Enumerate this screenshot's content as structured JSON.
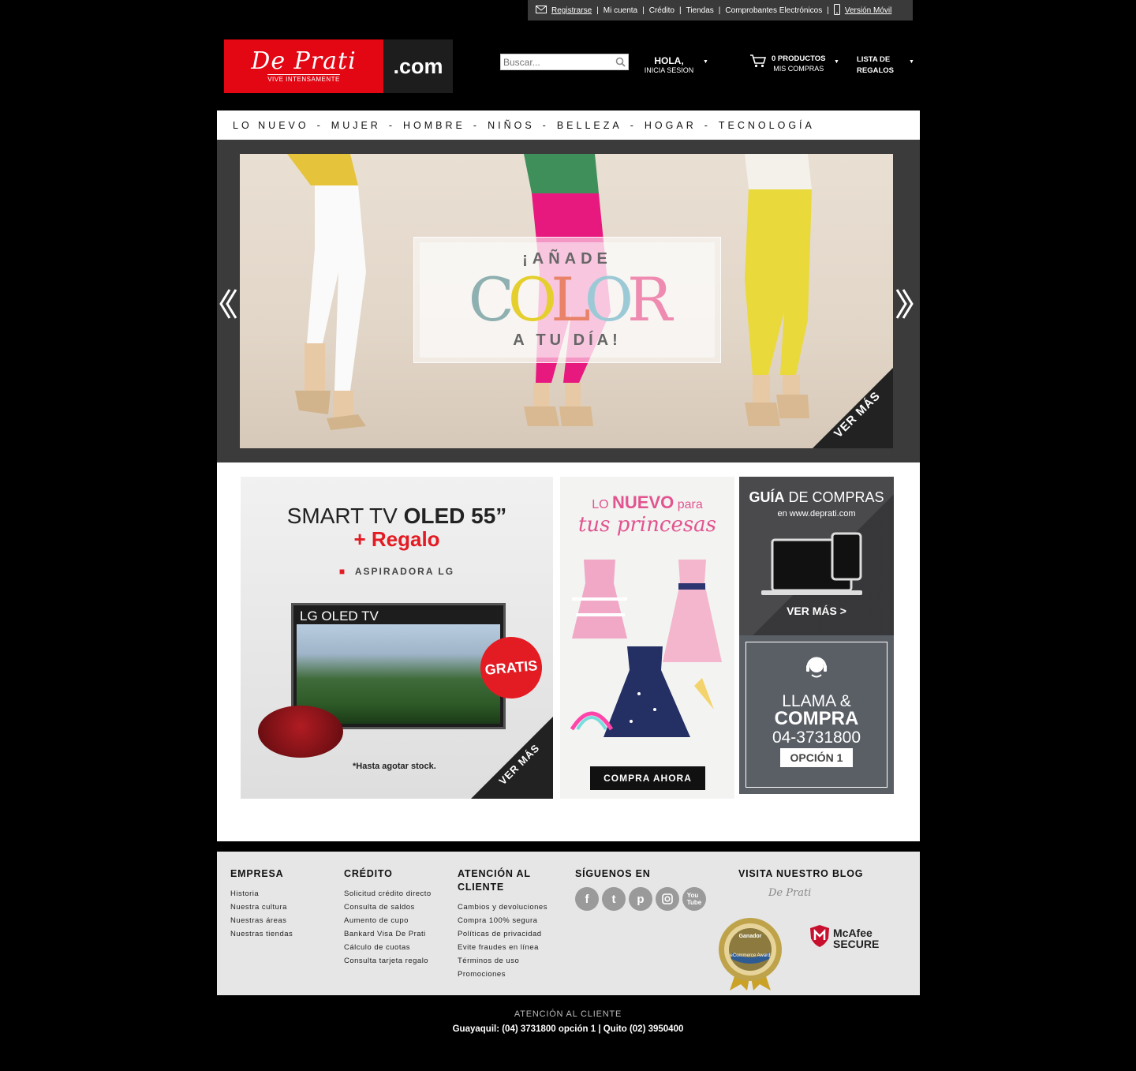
{
  "topbar": {
    "register": "Registrarse",
    "account": "Mi cuenta",
    "credit": "Crédito",
    "stores": "Tiendas",
    "invoices": "Comprobantes Electrónicos",
    "mobile": "Versión Móvil"
  },
  "logo": {
    "brand": "De Prati",
    "tagline": "VIVE INTENSAMENTE",
    "domain": ".com"
  },
  "search": {
    "placeholder": "Buscar..."
  },
  "user": {
    "greeting": "HOLA,",
    "login": "INICIA SESION"
  },
  "cart": {
    "count_label": "0 PRODUCTOS",
    "purchases": "MIS COMPRAS"
  },
  "gifts": {
    "line1": "LISTA DE",
    "line2": "REGALOS"
  },
  "nav": {
    "items": [
      "LO NUEVO",
      "MUJER",
      "HOMBRE",
      "NIÑOS",
      "BELLEZA",
      "HOGAR",
      "TECNOLOGÍA"
    ],
    "separator": "-"
  },
  "hero": {
    "line1": "¡AÑADE",
    "line2_letters": [
      "C",
      "O",
      "L",
      "O",
      "R"
    ],
    "line3": "A TU DÍA!",
    "cta": "VER MÁS"
  },
  "banners": {
    "tv": {
      "title_plain": "SMART TV ",
      "title_bold": "OLED 55”",
      "subtitle": "+ Regalo",
      "gift": "ASPIRADORA LG",
      "screen_brand": "LG OLED TV",
      "badge": "GRATIS",
      "stock": "*Hasta agotar stock.",
      "cta": "VER MÁS"
    },
    "princesas": {
      "line1_a": "LO ",
      "line1_b": "NUEVO",
      "line1_c": " para",
      "line2": "tus princesas",
      "cta": "COMPRA AHORA"
    },
    "guia": {
      "title_bold": "GUÍA",
      "title_rest": " DE COMPRAS",
      "url": "en www.deprati.com",
      "cta": "VER MÁS >"
    },
    "llama": {
      "line1": "LLAMA &",
      "line2": "COMPRA",
      "phone": "04-3731800",
      "option": "OPCIÓN 1"
    }
  },
  "footer": {
    "empresa": {
      "title": "EMPRESA",
      "links": [
        "Historia",
        "Nuestra cultura",
        "Nuestras áreas",
        "Nuestras tiendas"
      ]
    },
    "credito": {
      "title": "CRÉDITO",
      "links": [
        "Solicitud crédito directo",
        "Consulta de saldos",
        "Aumento de cupo",
        "Bankard Visa De Prati",
        "Cálculo de cuotas",
        "Consulta tarjeta regalo"
      ]
    },
    "atencion": {
      "title_1": "ATENCIÓN AL",
      "title_2": "CLIENTE",
      "links": [
        "Cambios y devoluciones",
        "Compra 100% segura",
        "Políticas de privacidad",
        "Evite fraudes en línea",
        "Términos de uso",
        "Promociones"
      ]
    },
    "social": {
      "title": "SÍGUENOS EN",
      "icons": [
        "f",
        "t",
        "p",
        "ig",
        "yt"
      ]
    },
    "blog": {
      "title": "VISITA NUESTRO BLOG",
      "logo_text": "De Prati"
    },
    "badge": {
      "line1": "Ganador",
      "line2": "eCommerce Award"
    },
    "mcafee": {
      "line1": "McAfee",
      "line2": "SECURE"
    }
  },
  "bottom": {
    "label": "ATENCIÓN AL CLIENTE",
    "phones": "Guayaquil: (04) 3731800 opción 1 | Quito (02) 3950400"
  },
  "colors": {
    "brand_red": "#e30613",
    "pink": "#e2548f",
    "footer_bg": "#e6e6e6"
  }
}
